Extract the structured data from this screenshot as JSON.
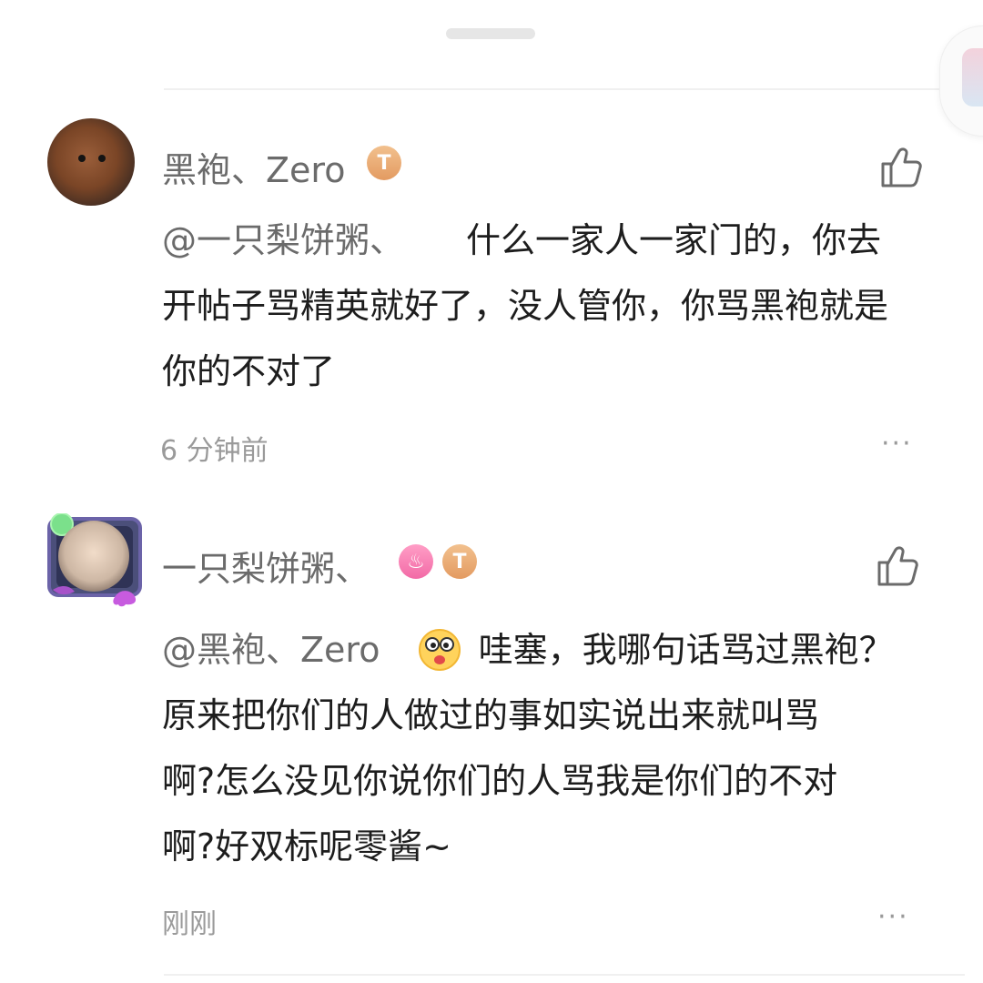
{
  "comments": [
    {
      "username": "黑袍、Zero",
      "badges": [
        "T4"
      ],
      "mention": "@一只梨饼粥、",
      "text_lines": [
        "什么一家人一家门的，你去",
        "开帖子骂精英就好了，没人管你，你骂黑袍就是",
        "你的不对了"
      ],
      "timestamp": "6 分钟前",
      "more_label": "···"
    },
    {
      "username": "一只梨饼粥、",
      "badges": [
        "fire",
        "T5"
      ],
      "mention": "@黑袍、Zero",
      "text_lines": [
        "哇塞，我哪句话骂过黑袍？",
        "原来把你们的人做过的事如实说出来就叫骂",
        "啊?怎么没见你说你们的人骂我是你们的不对",
        "啊?好双标呢零酱~"
      ],
      "timestamp": "刚刚",
      "more_label": "···"
    }
  ],
  "icons": {
    "like": "thumbs-up-icon",
    "more": "more-dots-icon"
  },
  "colors": {
    "username": "#6b6b6b",
    "text": "#1d1d1d",
    "meta": "#9a9a9a",
    "badge_t": "#e9a56d",
    "badge_fire": "#f26aa6"
  }
}
